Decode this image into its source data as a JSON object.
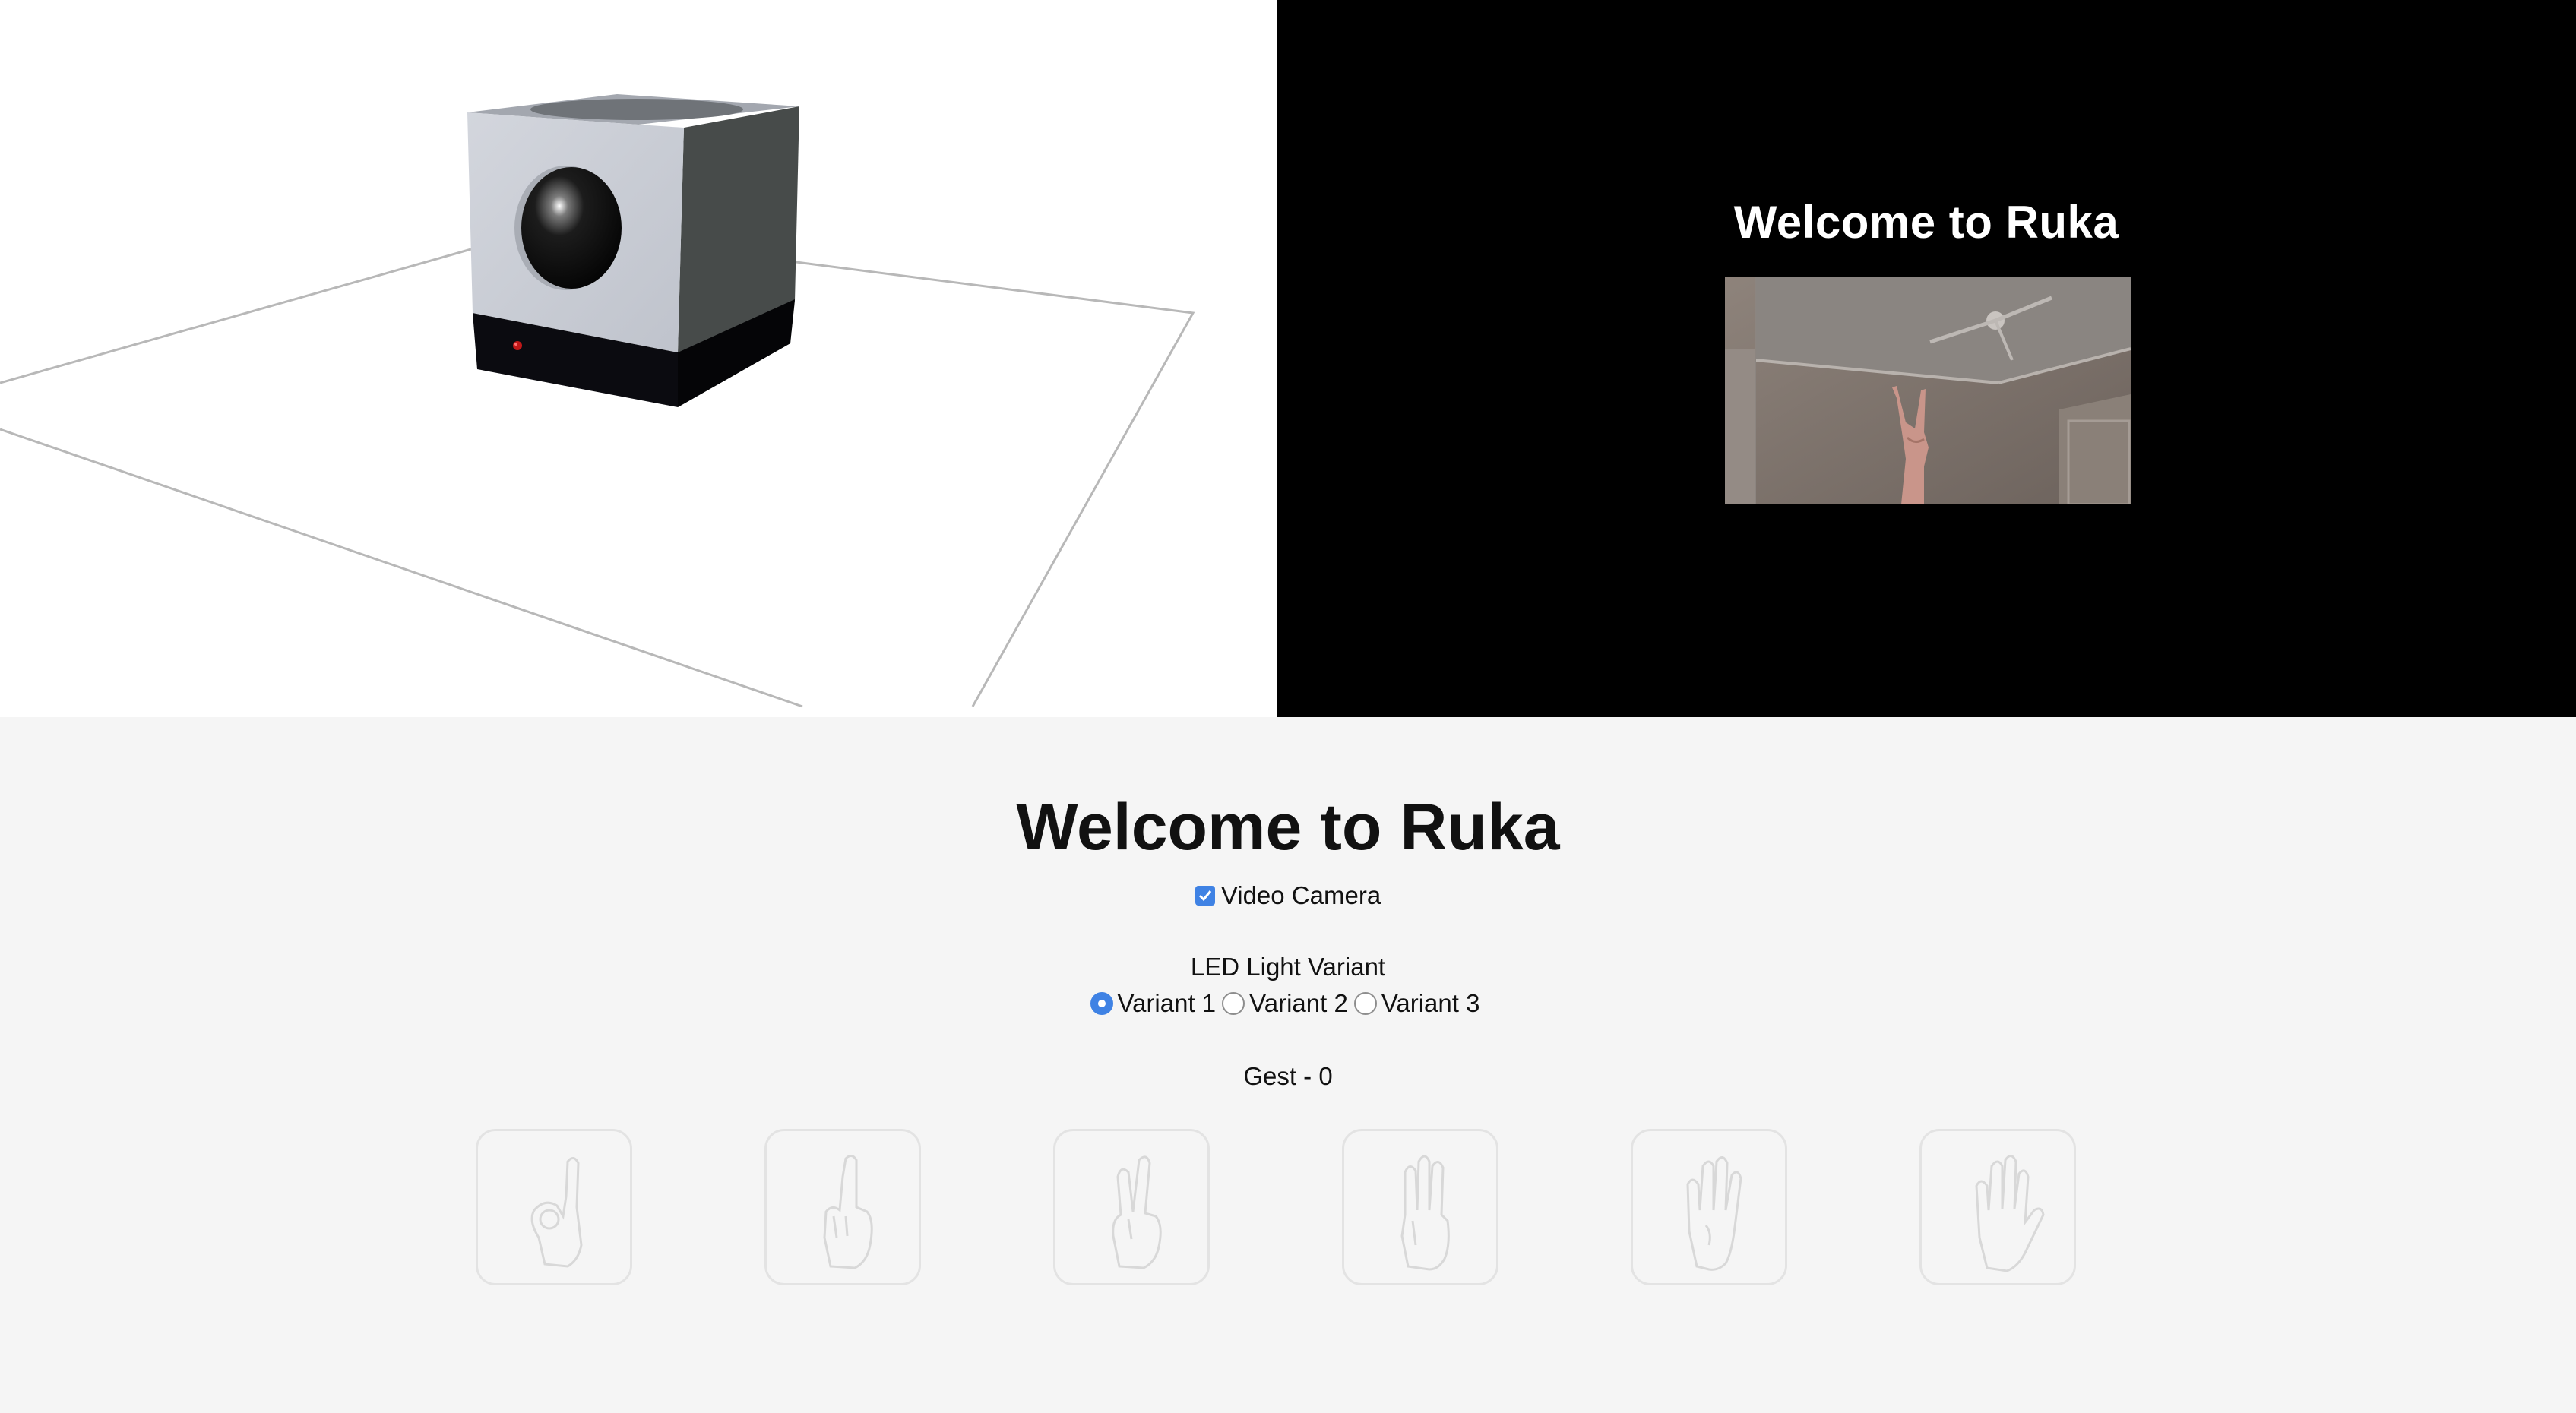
{
  "preview": {
    "title": "Welcome to Ruka"
  },
  "controls": {
    "title": "Welcome to Ruka",
    "video_camera": {
      "label": "Video Camera",
      "checked": true
    },
    "led": {
      "label": "LED Light Variant",
      "options": [
        "Variant 1",
        "Variant 2",
        "Variant 3"
      ],
      "selected": "Variant 1"
    },
    "gesture_text": "Gest - 0",
    "gestures": [
      {
        "icon": "ok-hand-gesture-icon"
      },
      {
        "icon": "one-finger-gesture-icon"
      },
      {
        "icon": "two-finger-gesture-icon"
      },
      {
        "icon": "three-finger-gesture-icon"
      },
      {
        "icon": "four-finger-gesture-icon"
      },
      {
        "icon": "open-palm-gesture-icon"
      }
    ]
  },
  "colors": {
    "accent": "#3f82e4",
    "page_bg": "#f5f5f5",
    "preview_bg": "#000000"
  }
}
